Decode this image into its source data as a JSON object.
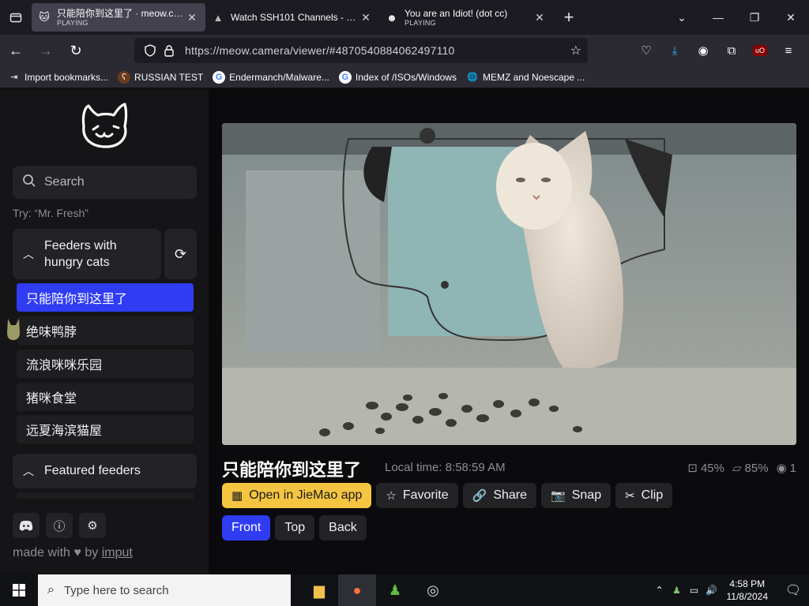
{
  "browser": {
    "tabs": [
      {
        "title": "只能陪你到这里了 · meow.camera",
        "status": "PLAYING",
        "favicon": "cat-icon",
        "active": true
      },
      {
        "title": "Watch SSH101 Channels - Free",
        "status": "",
        "favicon": "ssh-icon",
        "active": false
      },
      {
        "title": "You are an Idiot! (dot cc)",
        "status": "PLAYING",
        "favicon": "smiley-icon",
        "active": false
      }
    ],
    "url": "https://meow.camera/viewer/#4870540884062497110",
    "bookmarks": [
      {
        "label": "Import bookmarks...",
        "icon": "import-icon"
      },
      {
        "label": "RUSSIAN TEST",
        "icon": "bear-icon"
      },
      {
        "label": "Endermanch/Malware...",
        "icon": "google-icon"
      },
      {
        "label": "Index of /ISOs/Windows",
        "icon": "google-icon"
      },
      {
        "label": "MEMZ and Noescape ...",
        "icon": "globe-icon"
      }
    ]
  },
  "sidebar": {
    "search_placeholder": "Search",
    "try_hint": "Try: “Mr. Fresh”",
    "group_title": "Feeders with hungry cats",
    "feeders": [
      "只能陪你到这里了",
      "绝味鸭脖",
      "流浪咪咪乐园",
      "猪咪食堂",
      "远夏海滨猫屋"
    ],
    "featured_title": "Featured feeders",
    "made_with": "made with",
    "by": "by",
    "author": "imput"
  },
  "viewer": {
    "feeder_name": "只能陪你到这里了",
    "local_time": "Local time: 8:58:59 AM",
    "stats": {
      "food": "45%",
      "battery": "85%",
      "viewers": "1"
    },
    "actions": {
      "open_app": "Open in JieMao app",
      "favorite": "Favorite",
      "share": "Share",
      "snap": "Snap",
      "clip": "Clip"
    },
    "views": [
      "Front",
      "Top",
      "Back"
    ],
    "active_view": "Front"
  },
  "taskbar": {
    "search_placeholder": "Type here to search",
    "time": "4:58 PM",
    "date": "11/8/2024"
  },
  "colors": {
    "accent_blue": "#2f3cf2",
    "app_button_yellow": "#f5c542",
    "sidebar_bg": "#151517"
  }
}
